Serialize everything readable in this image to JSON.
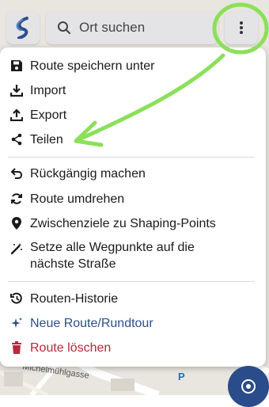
{
  "search": {
    "placeholder": "Ort suchen"
  },
  "menu": {
    "items": [
      {
        "label": "Route speichern unter",
        "icon": "save-icon"
      },
      {
        "label": "Import",
        "icon": "download-icon"
      },
      {
        "label": "Export",
        "icon": "upload-icon"
      },
      {
        "label": "Teilen",
        "icon": "share-icon"
      },
      {
        "label": "Rückgängig machen",
        "icon": "undo-icon"
      },
      {
        "label": "Route umdrehen",
        "icon": "reverse-icon"
      },
      {
        "label": "Zwischenziele zu Shaping-Points",
        "icon": "location-pin-icon"
      },
      {
        "label": "Setze alle Wegpunkte auf die",
        "label2": "nächste Straße",
        "icon": "magic-wand-icon"
      },
      {
        "label": "Routen-Historie",
        "icon": "history-icon"
      },
      {
        "label": "Neue Route/Rundtour",
        "icon": "sparkle-icon",
        "color": "#2c4f8c"
      },
      {
        "label": "Route löschen",
        "icon": "trash-icon",
        "color": "#b8283a"
      }
    ]
  },
  "map": {
    "street_label": "Michelmühlgasse",
    "parking_label": "P"
  },
  "colors": {
    "accent_blue": "#2c4f8c",
    "danger_red": "#b8283a",
    "annotation_green": "#8be05a"
  }
}
